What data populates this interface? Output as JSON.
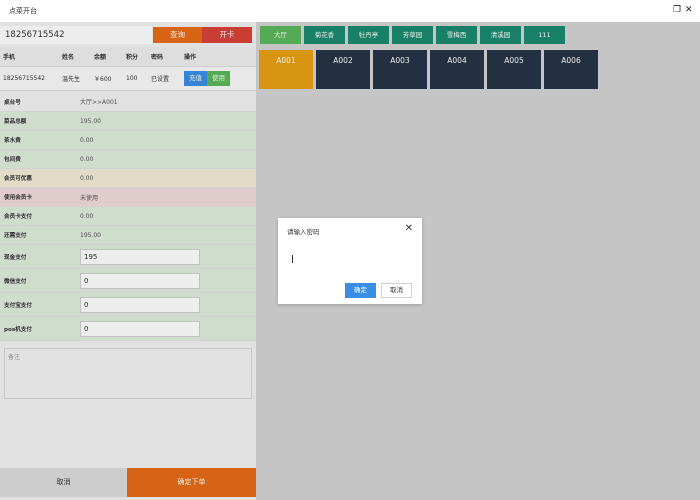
{
  "window": {
    "title": "点菜开台",
    "restore_icon": "restore-icon",
    "close_icon": "close-icon"
  },
  "member": {
    "phone_value": "18256715542",
    "query_label": "查询",
    "open_card_label": "开卡",
    "headers": [
      "手机",
      "姓名",
      "余额",
      "积分",
      "密码",
      "操作"
    ],
    "row": {
      "phone": "18256715542",
      "name": "温先生",
      "balance": "￥600",
      "points": "100",
      "password": "已设置"
    },
    "recharge_label": "充值",
    "use_label": "使用"
  },
  "summary": {
    "table_no": {
      "label": "桌台号",
      "value": "大厅>>A001"
    },
    "dish_total": {
      "label": "菜品总额",
      "value": "195.00"
    },
    "tea_fee": {
      "label": "茶水费",
      "value": "0.00"
    },
    "room_fee": {
      "label": "包间费",
      "value": "0.00"
    },
    "member_discount": {
      "label": "会员可优惠",
      "value": "0.00"
    },
    "use_member_card": {
      "label": "使用会员卡",
      "value": "未使用"
    },
    "card_pay": {
      "label": "会员卡支付",
      "value": "0.00"
    },
    "still_pay": {
      "label": "还需支付",
      "value": "195.00"
    },
    "cash_pay": {
      "label": "现金支付",
      "value": "195"
    },
    "wechat_pay": {
      "label": "微信支付",
      "value": "0"
    },
    "alipay_pay": {
      "label": "支付宝支付",
      "value": "0"
    },
    "pos_pay": {
      "label": "pos机支付",
      "value": "0"
    }
  },
  "note": {
    "placeholder": "备注"
  },
  "footer": {
    "cancel_label": "取消",
    "confirm_label": "确定下单"
  },
  "areas": [
    {
      "label": "大厅"
    },
    {
      "label": "菊花香"
    },
    {
      "label": "牡丹亭"
    },
    {
      "label": "芳草园"
    },
    {
      "label": "雪梅西"
    },
    {
      "label": "清溪园"
    },
    {
      "label": "111"
    }
  ],
  "tables": [
    {
      "label": "A001"
    },
    {
      "label": "A002"
    },
    {
      "label": "A003"
    },
    {
      "label": "A004"
    },
    {
      "label": "A005"
    },
    {
      "label": "A006"
    }
  ],
  "dialog": {
    "title": "请输入密码",
    "ok_label": "确定",
    "cancel_label": "取消"
  },
  "colors": {
    "accent": "#e76c16",
    "danger": "#d8433a",
    "primary": "#3a8ee6",
    "success": "#5cb85c",
    "area_tab": "#1a8a6e",
    "table_card": "#263446",
    "table_active": "#e8a114"
  }
}
